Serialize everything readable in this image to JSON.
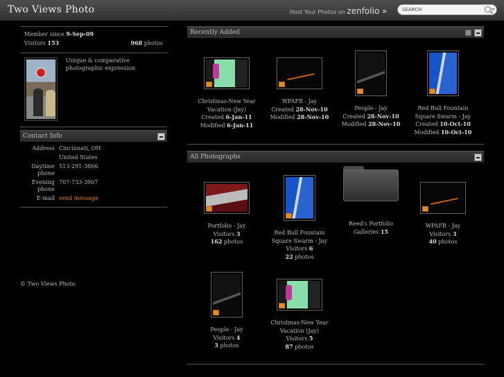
{
  "site": {
    "title": "Two Views Photo"
  },
  "promo": {
    "text": "Host Your Photos on",
    "brand": "zenfolio »"
  },
  "search": {
    "placeholder": "SEARCH"
  },
  "profile": {
    "member_since_label": "Member since",
    "member_since": "9-Sep-09",
    "visitors_label": "Visitors",
    "visitors": "153",
    "photos_count": "968",
    "photos_label": "photos",
    "bio": "Unique & comparative photographic expression"
  },
  "contact": {
    "title": "Contact Info",
    "rows": [
      {
        "key": "Address",
        "value": "Cincinnati, OH"
      },
      {
        "key": "",
        "value": "United States"
      },
      {
        "key": "Daytime phone",
        "value": "513-291-3866"
      },
      {
        "key": "Evening phone",
        "value": "707-733-3907"
      },
      {
        "key": "E-mail",
        "value": "send message"
      }
    ]
  },
  "footer": {
    "text": "© Two Views Photo"
  },
  "recent": {
    "title": "Recently Added",
    "items": [
      {
        "title": "Christmas-New Year Vacation (Jay)",
        "l1": "Created",
        "v1": "6-Jan-11",
        "l2": "Modified",
        "v2": "6-Jan-11"
      },
      {
        "title": "WPAFB - Jay",
        "l1": "Created",
        "v1": "28-Nov-10",
        "l2": "Modified",
        "v2": "28-Nov-10"
      },
      {
        "title": "People - Jay",
        "l1": "Created",
        "v1": "28-Nov-10",
        "l2": "Modified",
        "v2": "28-Nov-10"
      },
      {
        "title": "Red Bull Fountain Square Swarm - Jay",
        "l1": "Created",
        "v1": "10-Oct-10",
        "l2": "Modified",
        "v2": "10-Oct-10"
      }
    ]
  },
  "all": {
    "title": "All Photographs",
    "items": [
      {
        "title": "Portfolio - Jay",
        "l1": "Visitors",
        "v1": "3",
        "v2": "162",
        "l2": "photos"
      },
      {
        "title": "Red Bull Fountain Square Swarm - Jay",
        "l1": "Visitors",
        "v1": "6",
        "v2": "22",
        "l2": "photos"
      },
      {
        "title": "Reed's Portfolio",
        "l1": "Galleries",
        "v1": "15"
      },
      {
        "title": "WPAFB - Jay",
        "l1": "Visitors",
        "v1": "3",
        "v2": "40",
        "l2": "photos"
      },
      {
        "title": "People - Jay",
        "l1": "Visitors",
        "v1": "4",
        "v2": "3",
        "l2": "photos"
      },
      {
        "title": "Christmas-New Year Vacation (Jay)",
        "l1": "Visitors",
        "v1": "5",
        "v2": "87",
        "l2": "photos"
      }
    ]
  },
  "colors": {
    "link": "#e0832a",
    "badge": "#e08b2e"
  }
}
